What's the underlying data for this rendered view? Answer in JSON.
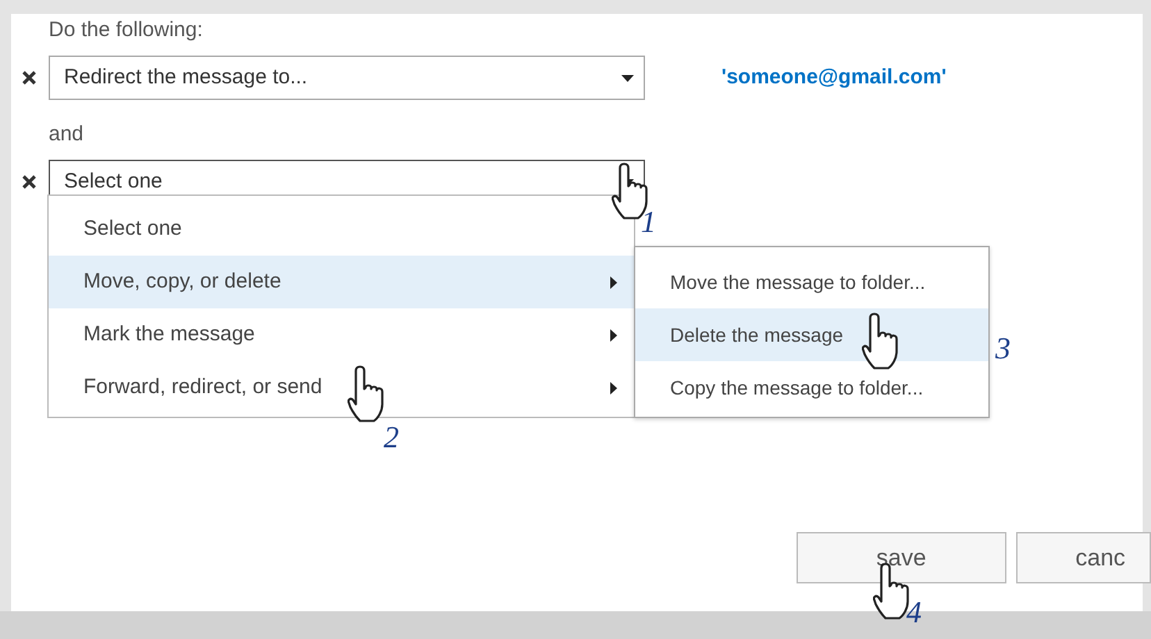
{
  "instruction": "Do the following:",
  "actions": [
    {
      "value": "Redirect the message to...",
      "argument": "'someone@gmail.com'",
      "open": false
    },
    {
      "value": "Select one",
      "open": true
    }
  ],
  "conjunction": "and",
  "menu": {
    "items": [
      {
        "label": "Select one",
        "selected": false,
        "has_submenu": false
      },
      {
        "label": "Move, copy, or delete",
        "selected": true,
        "has_submenu": true
      },
      {
        "label": "Mark the message",
        "selected": false,
        "has_submenu": true
      },
      {
        "label": "Forward, redirect, or send",
        "selected": false,
        "has_submenu": true
      }
    ]
  },
  "submenu": {
    "items": [
      {
        "label": "Move the message to folder...",
        "selected": false
      },
      {
        "label": "Delete the message",
        "selected": true
      },
      {
        "label": "Copy the message to folder...",
        "selected": false
      }
    ]
  },
  "buttons": [
    {
      "label": "save"
    },
    {
      "label": "canc"
    }
  ],
  "cursors": [
    {
      "step": "1"
    },
    {
      "step": "2"
    },
    {
      "step": "3"
    },
    {
      "step": "4"
    }
  ]
}
